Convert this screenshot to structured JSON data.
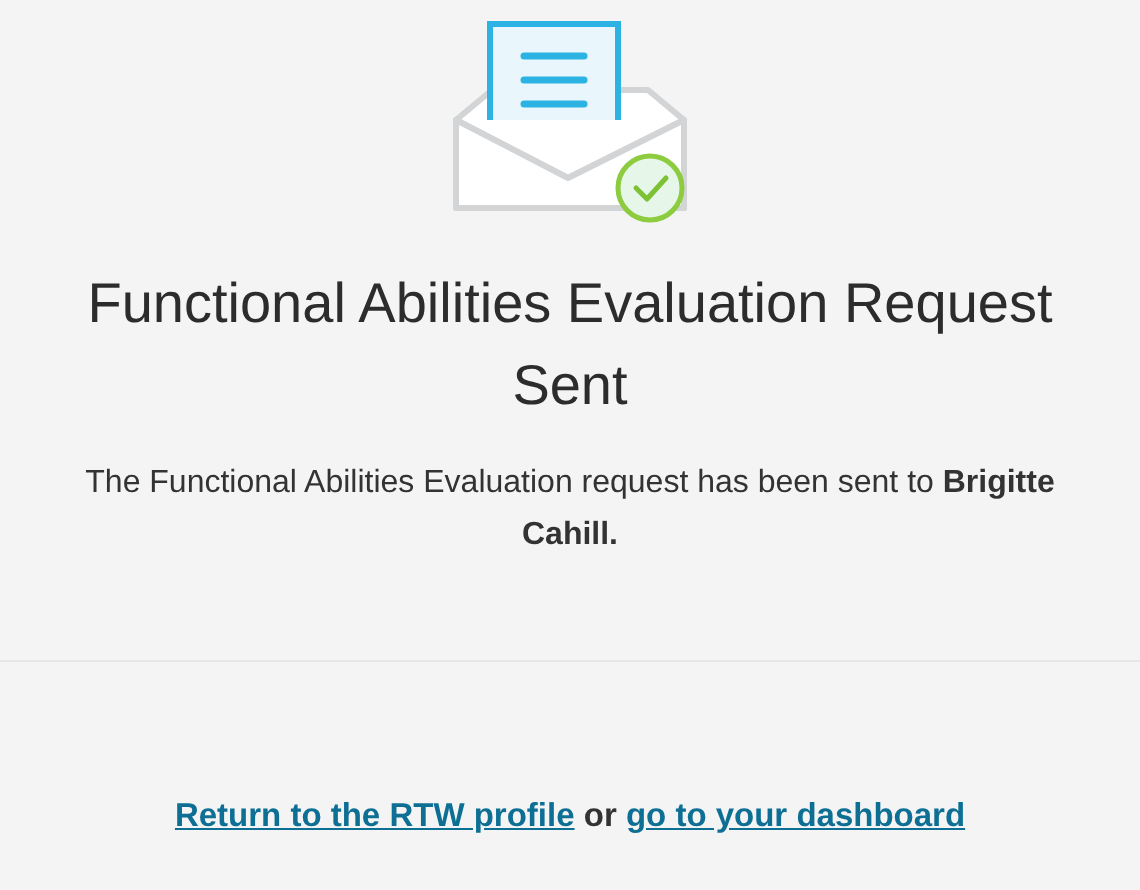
{
  "title": "Functional Abilities Evaluation Request Sent",
  "message": "The Functional Abilities Evaluation request has been sent to **Brigitte Cahill.**",
  "footer": {
    "links": [
      "Return to the RTW profile",
      "go to your dashboard"
    ],
    "separator": "or"
  }
}
